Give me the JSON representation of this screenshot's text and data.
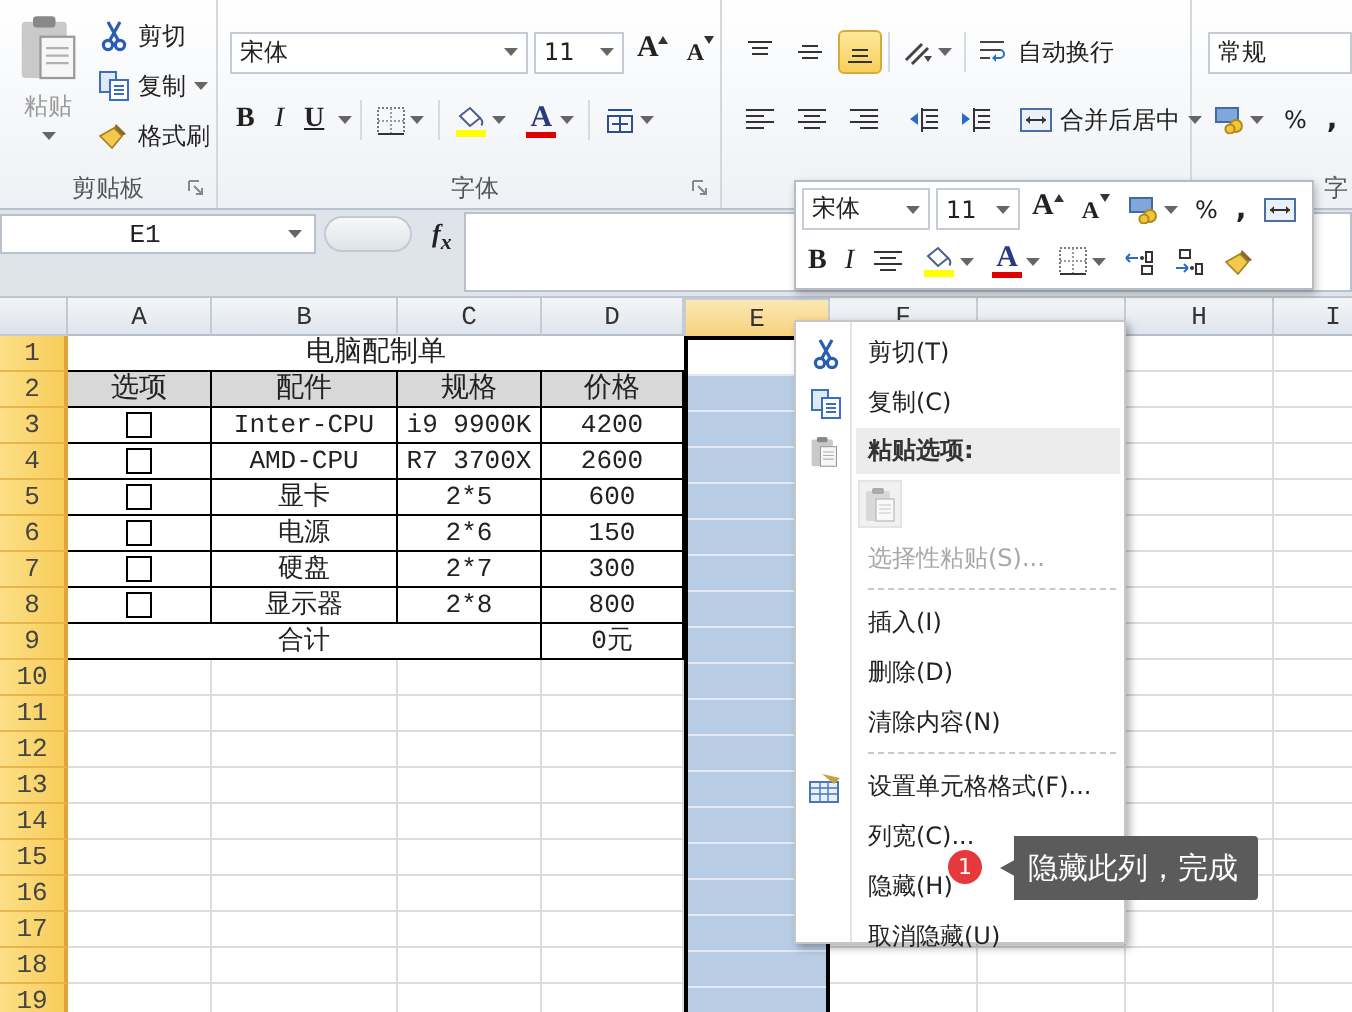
{
  "ribbon": {
    "clipboard": {
      "paste": {
        "label": "粘贴",
        "disabled": true
      },
      "buttons": [
        {
          "label": "剪切",
          "dropdown": false
        },
        {
          "label": "复制",
          "dropdown": true
        },
        {
          "label": "格式刷",
          "dropdown": false
        }
      ],
      "title": "剪贴板"
    },
    "font": {
      "name": "宋体",
      "size": "11",
      "grow": "A",
      "shrink": "A",
      "bold": "B",
      "italic": "I",
      "underline": "U",
      "font_color": "A",
      "title": "字体"
    },
    "alignment": {
      "vertical": [
        {
          "selected": false
        },
        {
          "selected": false
        },
        {
          "selected": true
        }
      ],
      "wrap_text": "自动换行",
      "merge": "合并后居中"
    },
    "number": {
      "format": "常规",
      "percent": "%",
      "comma": ",",
      "title": "字"
    }
  },
  "formula_bar": {
    "name_box": "E1",
    "function_label": "f$_{x}$"
  },
  "sheet": {
    "columns": [
      {
        "label": "A",
        "selected": false
      },
      {
        "label": "B",
        "selected": false
      },
      {
        "label": "C",
        "selected": false
      },
      {
        "label": "D",
        "selected": false
      },
      {
        "label": "E",
        "selected": true
      },
      {
        "label": "F",
        "selected": false
      },
      {
        "selected": false
      },
      {
        "label": "H",
        "selected": false
      },
      {
        "label": "I",
        "selected": false
      }
    ],
    "rows": [
      {
        "label": "1",
        "highlighted": true
      },
      {
        "label": "2",
        "highlighted": true
      },
      {
        "label": "3",
        "highlighted": true
      },
      {
        "label": "4",
        "highlighted": true
      },
      {
        "label": "5",
        "highlighted": true
      },
      {
        "label": "6",
        "highlighted": true
      },
      {
        "label": "7",
        "highlighted": true
      },
      {
        "label": "8",
        "highlighted": true
      },
      {
        "label": "9",
        "highlighted": true
      },
      {
        "label": "10",
        "highlighted": true
      },
      {
        "label": "11",
        "highlighted": true
      },
      {
        "label": "12",
        "highlighted": true
      },
      {
        "label": "13",
        "highlighted": true
      },
      {
        "label": "14",
        "highlighted": true
      },
      {
        "label": "15",
        "highlighted": true
      },
      {
        "label": "16",
        "highlighted": true
      },
      {
        "label": "17",
        "highlighted": true
      },
      {
        "label": "18",
        "highlighted": true
      },
      {
        "label": "19",
        "highlighted": true
      }
    ],
    "table": {
      "title": "电脑配制单",
      "headers": [
        "选项",
        "配件",
        "规格",
        "价格"
      ],
      "items": [
        {
          "checked": false,
          "part": "Inter-CPU",
          "spec": "i9 9900K",
          "price": "4200"
        },
        {
          "checked": false,
          "part": "AMD-CPU",
          "spec": "R7 3700X",
          "price": "2600"
        },
        {
          "checked": false,
          "part": "显卡",
          "spec": "2*5",
          "price": "600"
        },
        {
          "checked": false,
          "part": "电源",
          "spec": "2*6",
          "price": "150"
        },
        {
          "checked": false,
          "part": "硬盘",
          "spec": "2*7",
          "price": "300"
        },
        {
          "checked": false,
          "part": "显示器",
          "spec": "2*8",
          "price": "800"
        }
      ],
      "total_label": "合计",
      "total": "0元"
    }
  },
  "mini_toolbar": {
    "font": "宋体",
    "size": "11",
    "grow": "A",
    "shrink": "A",
    "percent": "%",
    "comma": ",",
    "bold": "B",
    "italic": "I",
    "font_color": "A"
  },
  "context_menu": [
    {
      "kind": "item",
      "label": "剪切(T)",
      "disabled": false
    },
    {
      "kind": "item",
      "label": "复制(C)",
      "disabled": false
    },
    {
      "kind": "heading",
      "label": "粘贴选项:"
    },
    {
      "kind": "paste-buttons",
      "disabled": true
    },
    {
      "kind": "item",
      "label": "选择性粘贴(S)...",
      "disabled": true
    },
    {
      "kind": "separator"
    },
    {
      "kind": "item",
      "label": "插入(I)",
      "disabled": false
    },
    {
      "kind": "item",
      "label": "删除(D)",
      "disabled": false
    },
    {
      "kind": "item",
      "label": "清除内容(N)",
      "disabled": false
    },
    {
      "kind": "separator"
    },
    {
      "kind": "item",
      "label": "设置单元格格式(F)...",
      "disabled": false
    },
    {
      "kind": "item",
      "label": "列宽(C)...",
      "disabled": false
    },
    {
      "kind": "item",
      "label": "隐藏(H)",
      "disabled": false
    },
    {
      "kind": "item",
      "label": "取消隐藏(U)",
      "disabled": false
    }
  ],
  "annotation": {
    "badge": "1",
    "text": "隐藏此列，完成"
  }
}
